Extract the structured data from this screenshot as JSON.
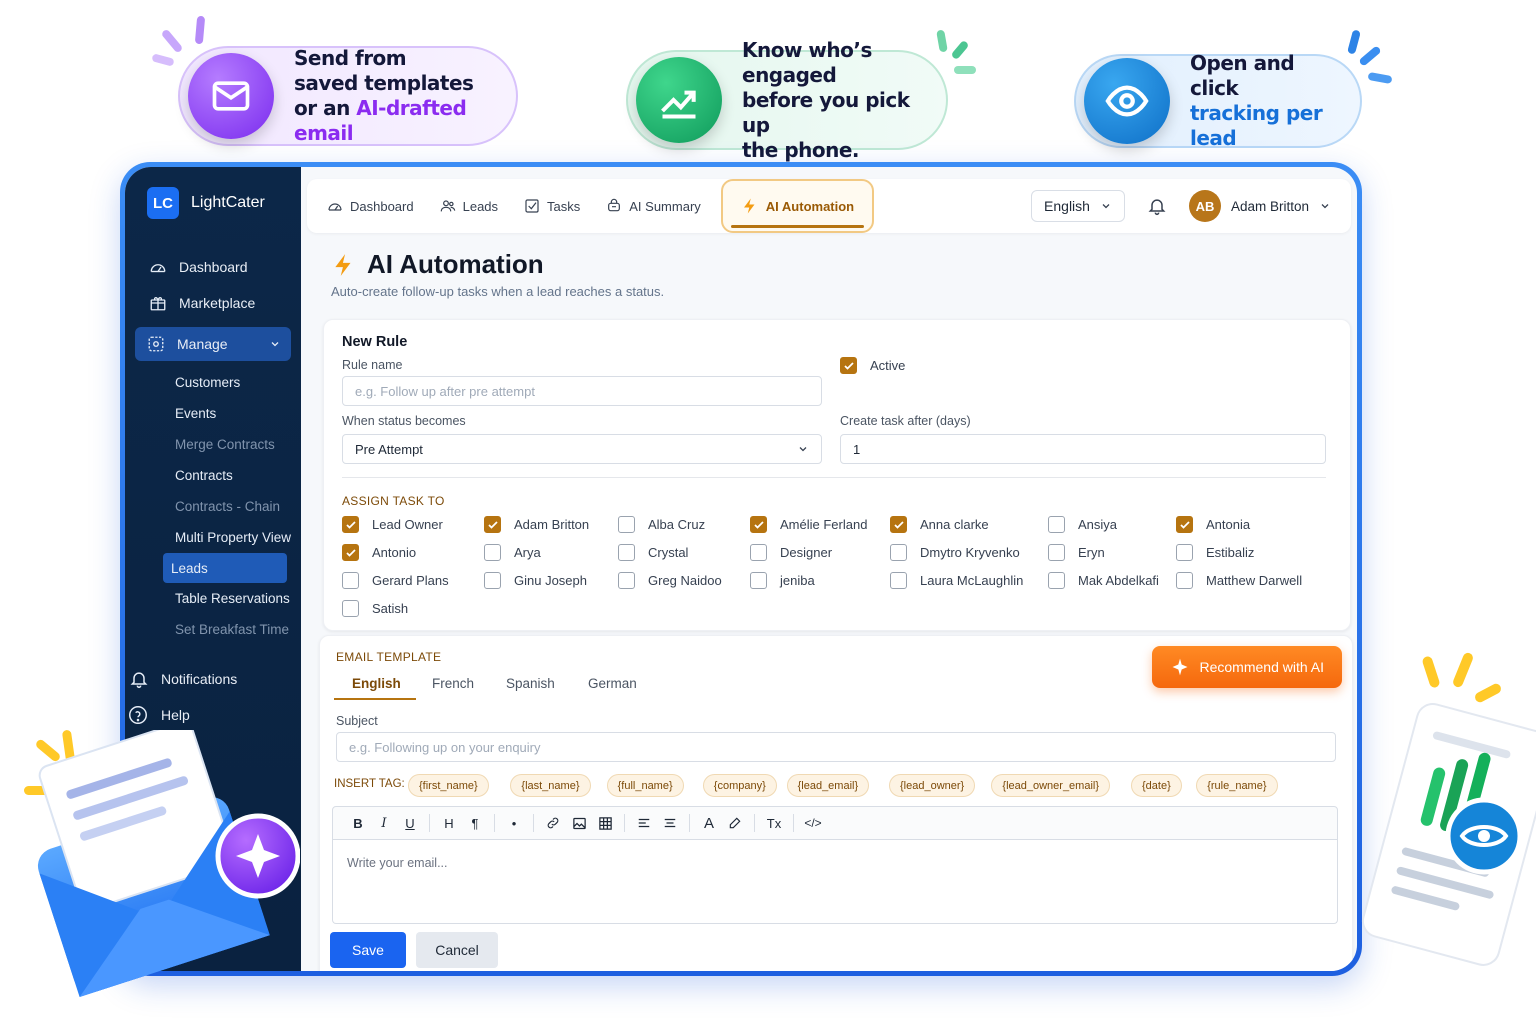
{
  "callouts": [
    {
      "line1": "Send from",
      "line2": "saved templates",
      "line3_plain": "or an ",
      "line3_accent": "AI-drafted email"
    },
    {
      "line1": "Know who’s engaged",
      "line2": "before you pick up",
      "line3": "the phone."
    },
    {
      "line1": "Open and click",
      "line2_accent": "tracking per lead"
    }
  ],
  "brand": {
    "logo": "LC",
    "name": "LightCater"
  },
  "sidebar": {
    "items": [
      {
        "label": "Dashboard",
        "icon": "dashboard-icon"
      },
      {
        "label": "Marketplace",
        "icon": "marketplace-icon"
      }
    ],
    "manage": {
      "label": "Manage",
      "icon": "manage-icon"
    },
    "sub_items": [
      {
        "label": "Customers",
        "dim": false
      },
      {
        "label": "Events",
        "dim": false
      },
      {
        "label": "Merge Contracts",
        "dim": true
      },
      {
        "label": "Contracts",
        "dim": false
      },
      {
        "label": "Contracts - Chain",
        "dim": true
      },
      {
        "label": "Multi Property View",
        "dim": false
      },
      {
        "label": "Leads",
        "active": true
      },
      {
        "label": "Table Reservations",
        "dim": false
      },
      {
        "label": "Set Breakfast Time",
        "dim": true
      }
    ],
    "bottom": [
      {
        "label": "Notifications",
        "icon": "bell-icon"
      },
      {
        "label": "Help",
        "icon": "help-icon"
      }
    ]
  },
  "topbar": {
    "tabs": [
      {
        "label": "Dashboard",
        "icon": "dashboard-icon"
      },
      {
        "label": "Leads",
        "icon": "users-icon"
      },
      {
        "label": "Tasks",
        "icon": "tasks-icon"
      },
      {
        "label": "AI Summary",
        "icon": "ai-summary-icon"
      }
    ],
    "active_tab": "AI Automation",
    "language": "English",
    "user": {
      "initials": "AB",
      "name": "Adam Britton"
    }
  },
  "page": {
    "title": "AI Automation",
    "subtitle": "Auto-create follow-up tasks when a lead reaches a status."
  },
  "rule": {
    "heading": "New Rule",
    "rule_name_label": "Rule name",
    "rule_name_placeholder": "e.g. Follow up after pre attempt",
    "active_label": "Active",
    "active_checked": true,
    "status_label": "When status becomes",
    "status_value": "Pre Attempt",
    "days_label": "Create task after (days)",
    "days_value": "1",
    "assign_title": "ASSIGN TASK TO",
    "assignees": [
      [
        "Lead Owner",
        true
      ],
      [
        "Adam Britton",
        true
      ],
      [
        "Alba Cruz",
        false
      ],
      [
        "Amélie Ferland",
        true
      ],
      [
        "Anna clarke",
        true
      ],
      [
        "Ansiya",
        false
      ],
      [
        "Antonia",
        true
      ],
      [
        "Antonio",
        true
      ],
      [
        "Arya",
        false
      ],
      [
        "Crystal",
        false
      ],
      [
        "Designer",
        false
      ],
      [
        "Dmytro Kryvenko",
        false
      ],
      [
        "Eryn",
        false
      ],
      [
        "Estibaliz",
        false
      ],
      [
        "Gerard Plans",
        false
      ],
      [
        "Ginu Joseph",
        false
      ],
      [
        "Greg Naidoo",
        false
      ],
      [
        "jeniba",
        false
      ],
      [
        "Laura McLaughlin",
        false
      ],
      [
        "Mak Abdelkafi",
        false
      ],
      [
        "Matthew Darwell",
        false
      ],
      [
        "Satish",
        false
      ]
    ]
  },
  "email": {
    "title": "EMAIL TEMPLATE",
    "ai_button": "Recommend with AI",
    "languages": [
      "English",
      "French",
      "Spanish",
      "German"
    ],
    "subject_label": "Subject",
    "subject_placeholder": "e.g. Following up on your enquiry",
    "insert_tag_label": "INSERT TAG:",
    "tags": [
      "{first_name}",
      "{last_name}",
      "{full_name}",
      "{company}",
      "{lead_email}",
      "{lead_owner}",
      "{lead_owner_email}",
      "{date}",
      "{rule_name}"
    ],
    "toolbar": [
      "B",
      "I",
      "U",
      "H",
      "¶",
      "•",
      "link",
      "image",
      "table",
      "align-left",
      "align-center",
      "A",
      "pen",
      "Tx",
      "</>"
    ],
    "body_placeholder": "Write your email...",
    "save": "Save",
    "cancel": "Cancel"
  }
}
